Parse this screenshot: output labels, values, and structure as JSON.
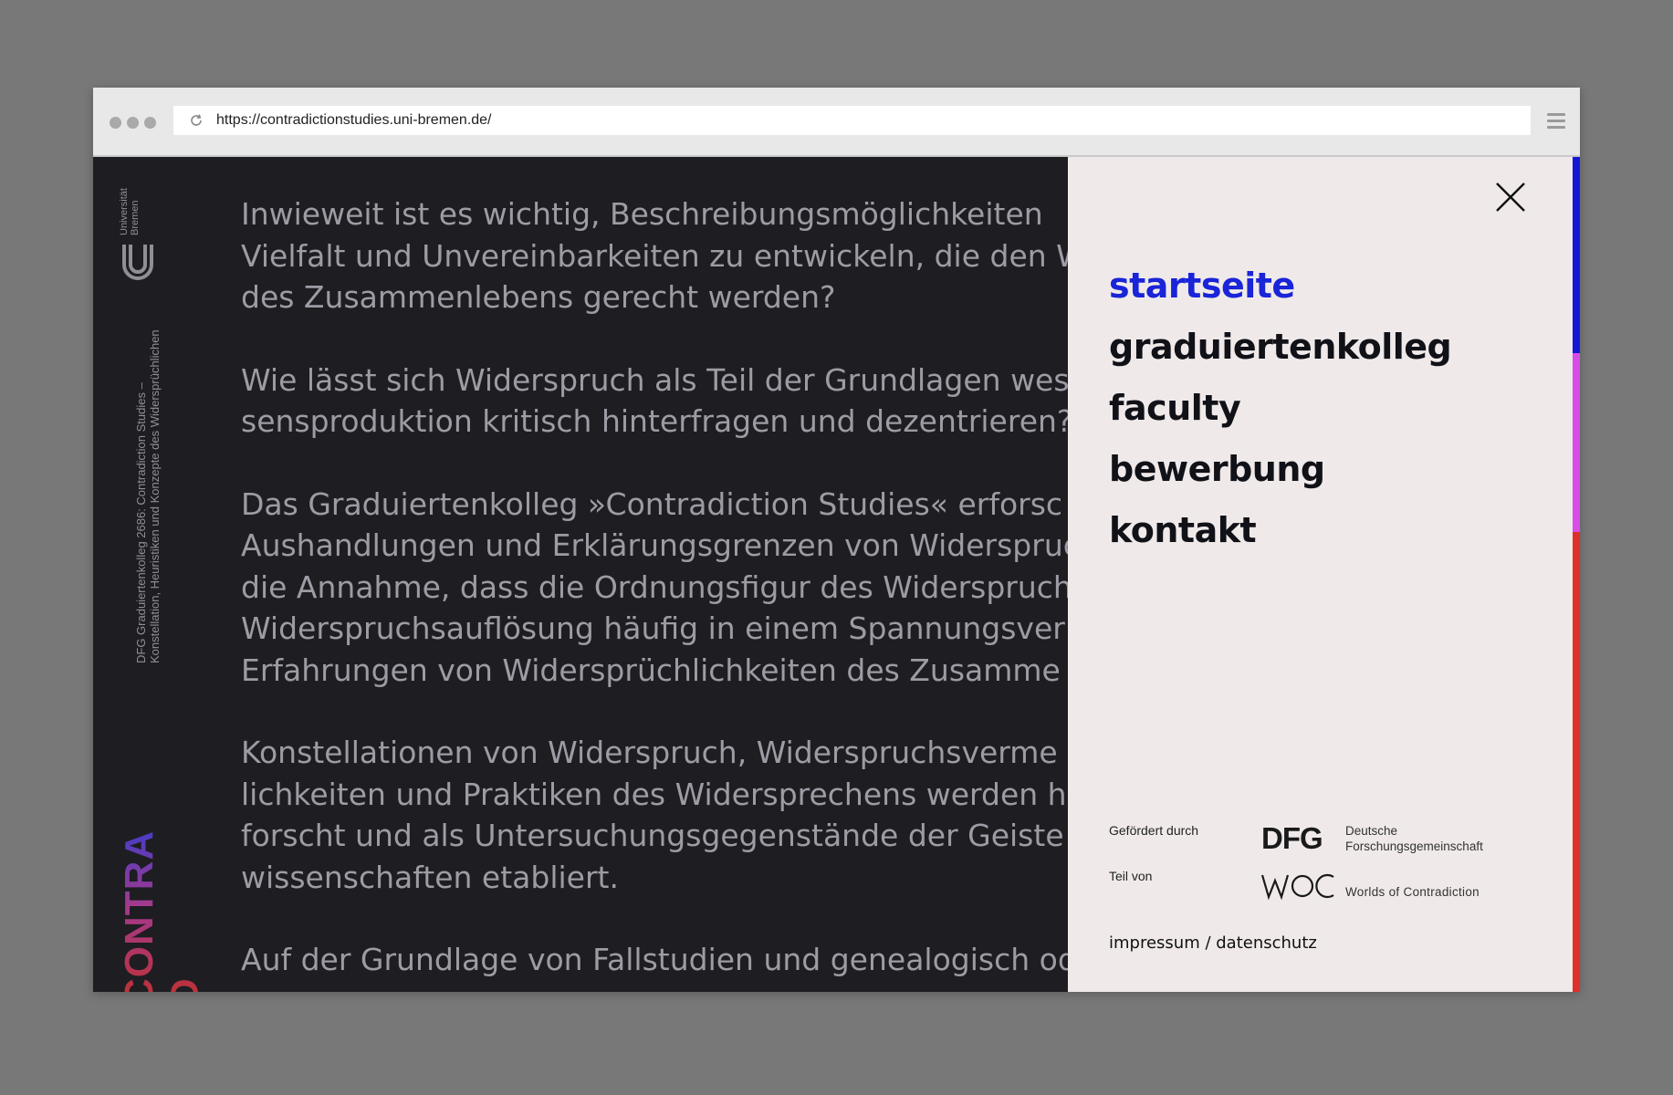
{
  "browser": {
    "url": "https://contradictionstudies.uni-bremen.de/"
  },
  "rail": {
    "university": "Universität Bremen",
    "description_line1": "DFG Graduiertenkolleg 2686: Contradiction Studies –",
    "description_line2": "Konstellation, Heuristiken und Konzepte des Widersprüchlichen",
    "logo_text": "CONTRA D"
  },
  "content": {
    "paragraphs": [
      [
        "Inwieweit ist es wichtig, Beschreibungsmöglichkeiten",
        "Vielfalt und Unvereinbarkeiten zu entwickeln, die den W",
        "des Zusammenlebens gerecht werden?"
      ],
      [
        "Wie lässt sich Widerspruch als Teil der Grundlagen wes",
        "sensproduktion kritisch hinterfragen und dezentrieren?"
      ],
      [
        "Das Graduiertenkolleg »Contradiction Studies« erforsc",
        "Aushandlungen und Erklärungsgrenzen von Widerspruc",
        "die Annahme, dass die Ordnungsfigur des Widerspruch",
        "Widerspruchsauflösung häufig in einem Spannungsver",
        "Erfahrungen von Widersprüchlichkeiten des Zusamme"
      ],
      [
        "Konstellationen von Widerspruch, Widerspruchsverme",
        "lichkeiten und Praktiken des Widersprechens werden h",
        "forscht und als Untersuchungsgegenstände der Geiste",
        "wissenschaften etabliert."
      ],
      [
        "Auf der Grundlage von Fallstudien und genealogisch od"
      ]
    ]
  },
  "menu": {
    "items": [
      "startseite",
      "graduiertenkolleg",
      "faculty",
      "bewerbung",
      "kontakt"
    ],
    "active_index": 0,
    "funded_label": "Gefördert durch",
    "dfg_logo": "DFG",
    "dfg_name_line1": "Deutsche",
    "dfg_name_line2": "Forschungsgemeinschaft",
    "part_label": "Teil von",
    "woc_name": "Worlds of Contradiction",
    "legal": "impressum / datenschutz"
  },
  "colors": {
    "accent_blue": "#1a24d8",
    "bar": [
      "#1616d8",
      "#d84de8",
      "#e0302a"
    ]
  }
}
